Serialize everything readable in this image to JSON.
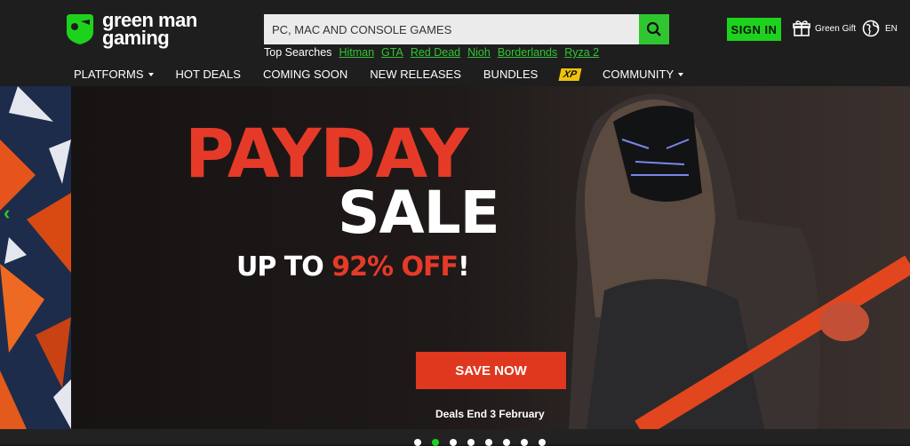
{
  "header": {
    "logo_line1": "green man",
    "logo_line2": "gaming",
    "search_placeholder": "PC, MAC AND CONSOLE GAMES",
    "top_searches_label": "Top Searches",
    "top_searches": [
      "Hitman",
      "GTA",
      "Red Dead",
      "Nioh",
      "Borderlands",
      "Ryza 2"
    ],
    "signin_label": "SIGN IN",
    "gift_label": "Green Gift",
    "lang_label": "EN"
  },
  "nav": {
    "platforms": "PLATFORMS",
    "hot_deals": "HOT DEALS",
    "coming_soon": "COMING SOON",
    "new_releases": "NEW RELEASES",
    "bundles": "BUNDLES",
    "xp": "XP",
    "community": "COMMUNITY"
  },
  "banner": {
    "line1": "PAYDAY",
    "line2": "SALE",
    "line3_prefix": "UP TO ",
    "line3_pct": "92% OFF",
    "line3_suffix": "!",
    "cta": "SAVE NOW",
    "deadline": "Deals End 3 February"
  },
  "carousel": {
    "slide_count": 8,
    "active_index": 1
  },
  "colors": {
    "brand_green": "#1dd21d",
    "sale_red": "#e63a28",
    "cta_red": "#e0381f",
    "xp_yellow": "#f0c20c"
  }
}
